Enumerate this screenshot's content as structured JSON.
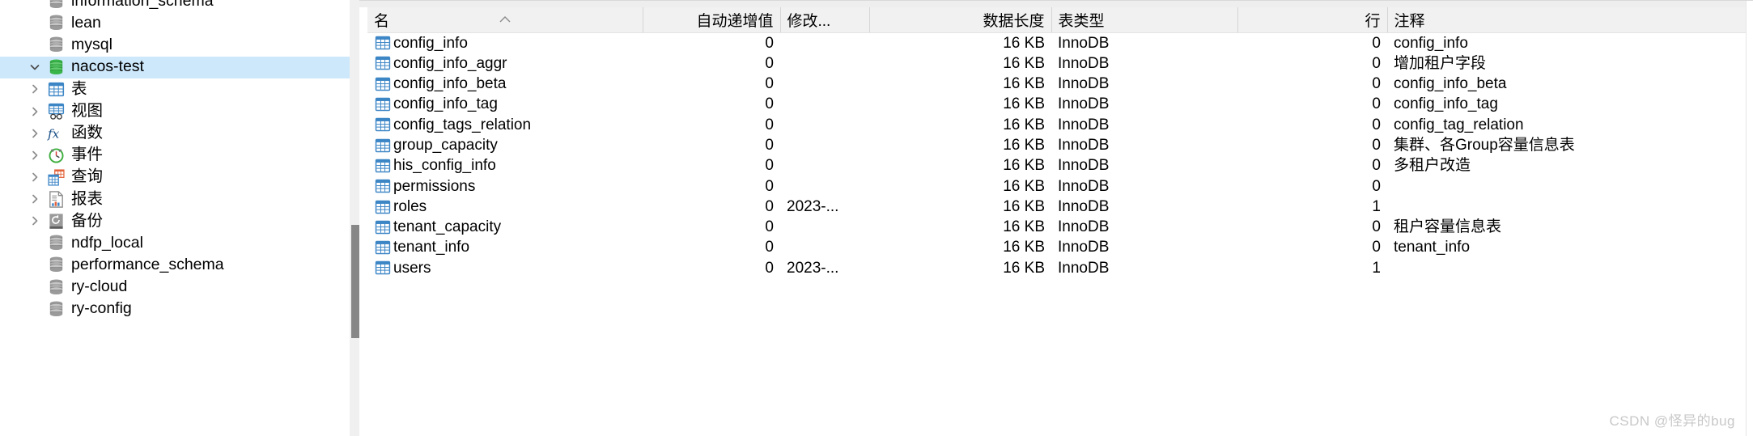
{
  "sidebar": {
    "items": [
      {
        "label": "information_schema",
        "icon": "database-icon",
        "level": 0,
        "state": "partial-top",
        "selected": false,
        "twisty": "none",
        "color": "#7d7d7d"
      },
      {
        "label": "lean",
        "icon": "database-icon",
        "level": 0,
        "selected": false,
        "twisty": "none",
        "color": "#7d7d7d"
      },
      {
        "label": "mysql",
        "icon": "database-icon",
        "level": 0,
        "selected": false,
        "twisty": "none",
        "color": "#7d7d7d"
      },
      {
        "label": "nacos-test",
        "icon": "database-icon-active",
        "level": 0,
        "selected": true,
        "twisty": "expanded",
        "color": "#2fa52f"
      },
      {
        "label": "表",
        "icon": "table-icon",
        "level": 1,
        "selected": false,
        "twisty": "collapsed"
      },
      {
        "label": "视图",
        "icon": "view-icon",
        "level": 1,
        "selected": false,
        "twisty": "collapsed"
      },
      {
        "label": "函数",
        "icon": "function-icon",
        "level": 1,
        "selected": false,
        "twisty": "collapsed"
      },
      {
        "label": "事件",
        "icon": "event-clock-icon",
        "level": 1,
        "selected": false,
        "twisty": "collapsed"
      },
      {
        "label": "查询",
        "icon": "query-icon",
        "level": 1,
        "selected": false,
        "twisty": "collapsed"
      },
      {
        "label": "报表",
        "icon": "report-icon",
        "level": 1,
        "selected": false,
        "twisty": "collapsed"
      },
      {
        "label": "备份",
        "icon": "backup-icon",
        "level": 1,
        "selected": false,
        "twisty": "collapsed"
      },
      {
        "label": "ndfp_local",
        "icon": "database-icon",
        "level": 0,
        "selected": false,
        "twisty": "none",
        "color": "#7d7d7d"
      },
      {
        "label": "performance_schema",
        "icon": "database-icon",
        "level": 0,
        "selected": false,
        "twisty": "none",
        "color": "#7d7d7d"
      },
      {
        "label": "ry-cloud",
        "icon": "database-icon",
        "level": 0,
        "selected": false,
        "twisty": "none",
        "color": "#7d7d7d"
      },
      {
        "label": "ry-config",
        "icon": "database-icon",
        "level": 0,
        "selected": false,
        "twisty": "none",
        "color": "#7d7d7d"
      }
    ],
    "selected_color": "#cde8fb",
    "scrollbar": {
      "track_color": "#f0f0f0",
      "thumb_color": "#878787"
    }
  },
  "table": {
    "columns": [
      {
        "key": "name",
        "label": "名",
        "align": "left",
        "sorted": "asc"
      },
      {
        "key": "auto_inc",
        "label": "自动递增值",
        "align": "right",
        "sorted": "none"
      },
      {
        "key": "modified",
        "label": "修改...",
        "align": "left",
        "sorted": "none"
      },
      {
        "key": "data_len",
        "label": "数据长度",
        "align": "right",
        "sorted": "none"
      },
      {
        "key": "engine",
        "label": "表类型",
        "align": "left",
        "sorted": "none"
      },
      {
        "key": "rows",
        "label": "行",
        "align": "right",
        "sorted": "none"
      },
      {
        "key": "comment",
        "label": "注释",
        "align": "left",
        "sorted": "none"
      }
    ],
    "sort_indicator": "caret-up",
    "header_bg": "#f1f1f1",
    "rows": [
      {
        "name": "config_info",
        "icon": "table-icon",
        "auto_inc": "0",
        "modified": "",
        "data_len": "16 KB",
        "engine": "InnoDB",
        "rows": "0",
        "comment": "config_info"
      },
      {
        "name": "config_info_aggr",
        "icon": "table-icon",
        "auto_inc": "0",
        "modified": "",
        "data_len": "16 KB",
        "engine": "InnoDB",
        "rows": "0",
        "comment": "增加租户字段"
      },
      {
        "name": "config_info_beta",
        "icon": "table-icon",
        "auto_inc": "0",
        "modified": "",
        "data_len": "16 KB",
        "engine": "InnoDB",
        "rows": "0",
        "comment": "config_info_beta"
      },
      {
        "name": "config_info_tag",
        "icon": "table-icon",
        "auto_inc": "0",
        "modified": "",
        "data_len": "16 KB",
        "engine": "InnoDB",
        "rows": "0",
        "comment": "config_info_tag"
      },
      {
        "name": "config_tags_relation",
        "icon": "table-icon",
        "auto_inc": "0",
        "modified": "",
        "data_len": "16 KB",
        "engine": "InnoDB",
        "rows": "0",
        "comment": "config_tag_relation"
      },
      {
        "name": "group_capacity",
        "icon": "table-icon",
        "auto_inc": "0",
        "modified": "",
        "data_len": "16 KB",
        "engine": "InnoDB",
        "rows": "0",
        "comment": "集群、各Group容量信息表"
      },
      {
        "name": "his_config_info",
        "icon": "table-icon",
        "auto_inc": "0",
        "modified": "",
        "data_len": "16 KB",
        "engine": "InnoDB",
        "rows": "0",
        "comment": "多租户改造"
      },
      {
        "name": "permissions",
        "icon": "table-icon",
        "auto_inc": "0",
        "modified": "",
        "data_len": "16 KB",
        "engine": "InnoDB",
        "rows": "0",
        "comment": ""
      },
      {
        "name": "roles",
        "icon": "table-icon",
        "auto_inc": "0",
        "modified": "2023-...",
        "data_len": "16 KB",
        "engine": "InnoDB",
        "rows": "1",
        "comment": ""
      },
      {
        "name": "tenant_capacity",
        "icon": "table-icon",
        "auto_inc": "0",
        "modified": "",
        "data_len": "16 KB",
        "engine": "InnoDB",
        "rows": "0",
        "comment": "租户容量信息表"
      },
      {
        "name": "tenant_info",
        "icon": "table-icon",
        "auto_inc": "0",
        "modified": "",
        "data_len": "16 KB",
        "engine": "InnoDB",
        "rows": "0",
        "comment": "tenant_info"
      },
      {
        "name": "users",
        "icon": "table-icon",
        "auto_inc": "0",
        "modified": "2023-...",
        "data_len": "16 KB",
        "engine": "InnoDB",
        "rows": "1",
        "comment": ""
      }
    ]
  },
  "watermark": {
    "text": "CSDN @怪异的bug",
    "color": "#c8c8c8"
  }
}
